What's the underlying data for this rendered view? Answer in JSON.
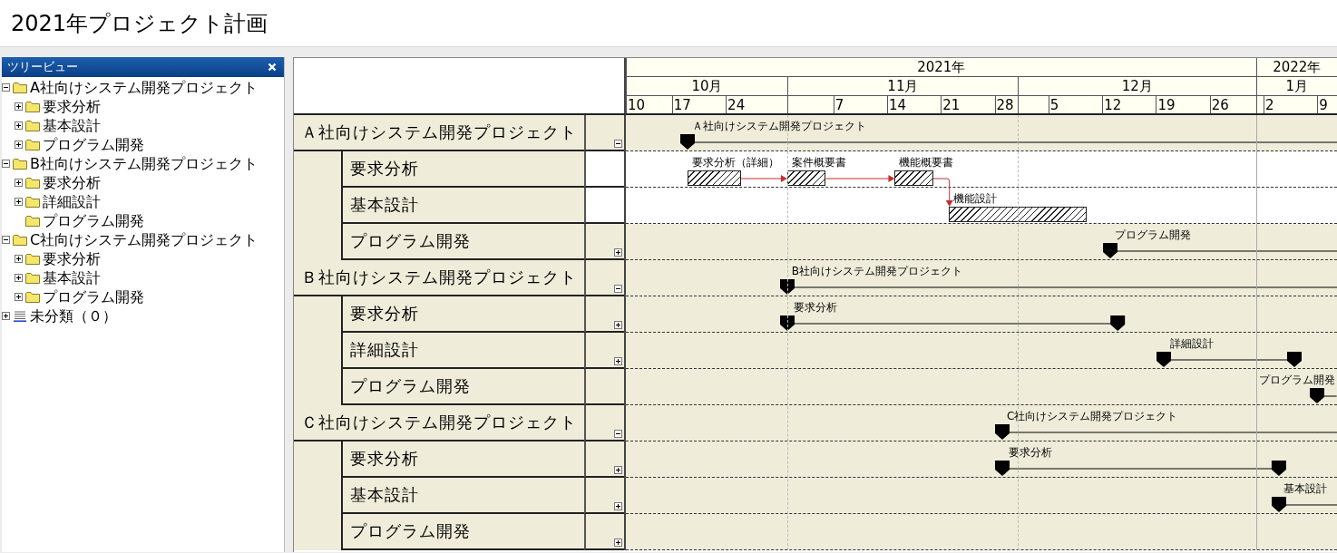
{
  "title": "2021年プロジェクト計画",
  "tree": {
    "header": "ツリービュー",
    "nodes": [
      {
        "label": "A社向けシステム開発プロジェクト",
        "kind": "folder",
        "expanded": true,
        "children": [
          {
            "label": "要求分析",
            "kind": "folder",
            "expanded": false
          },
          {
            "label": "基本設計",
            "kind": "folder",
            "expanded": false
          },
          {
            "label": "プログラム開発",
            "kind": "folder",
            "expanded": false
          }
        ]
      },
      {
        "label": "B社向けシステム開発プロジェクト",
        "kind": "folder",
        "expanded": true,
        "children": [
          {
            "label": "要求分析",
            "kind": "folder",
            "expanded": false
          },
          {
            "label": "詳細設計",
            "kind": "folder",
            "expanded": false
          },
          {
            "label": "プログラム開発",
            "kind": "leaf"
          }
        ]
      },
      {
        "label": "C社向けシステム開発プロジェクト",
        "kind": "folder",
        "expanded": true,
        "children": [
          {
            "label": "要求分析",
            "kind": "folder",
            "expanded": false
          },
          {
            "label": "基本設計",
            "kind": "folder",
            "expanded": false
          },
          {
            "label": "プログラム開発",
            "kind": "folder",
            "expanded": false
          }
        ]
      },
      {
        "label": "未分類（０）",
        "kind": "list",
        "expanded": false
      }
    ]
  },
  "timeline": {
    "years": [
      {
        "label": "2021年"
      },
      {
        "label": "2022年"
      }
    ],
    "months": [
      {
        "label": "10月"
      },
      {
        "label": "11月"
      },
      {
        "label": "12月"
      },
      {
        "label": "1月"
      }
    ],
    "weeks": [
      {
        "label": "10"
      },
      {
        "label": "17"
      },
      {
        "label": "24"
      },
      {
        "label": "7"
      },
      {
        "label": "14"
      },
      {
        "label": "21"
      },
      {
        "label": "28"
      },
      {
        "label": "5"
      },
      {
        "label": "12"
      },
      {
        "label": "19"
      },
      {
        "label": "26"
      },
      {
        "label": "2"
      },
      {
        "label": "9"
      }
    ]
  },
  "gantt": {
    "rows": [
      {
        "label": "Ａ社向けシステム開発プロジェクト",
        "kind": "project",
        "expanded": true,
        "items": [
          {
            "kind": "summary",
            "label": "Ａ社向けシステム開発プロジェクト"
          }
        ]
      },
      {
        "label": "要求分析",
        "kind": "open_task",
        "items": [
          {
            "kind": "bar",
            "label": "要求分析（詳細）",
            "linked": true
          },
          {
            "kind": "bar",
            "label": "案件概要書",
            "linked": true
          },
          {
            "kind": "bar",
            "label": "機能概要書",
            "linked": true
          }
        ]
      },
      {
        "label": "基本設計",
        "kind": "open_task",
        "items": [
          {
            "kind": "bar",
            "label": "機能設計"
          }
        ]
      },
      {
        "label": "プログラム開発",
        "kind": "task",
        "expanded": false,
        "items": [
          {
            "kind": "summary",
            "label": "プログラム開発"
          }
        ]
      },
      {
        "label": "Ｂ社向けシステム開発プロジェクト",
        "kind": "project",
        "expanded": true,
        "items": [
          {
            "kind": "summary",
            "label": "B社向けシステム開発プロジェクト"
          }
        ]
      },
      {
        "label": "要求分析",
        "kind": "task",
        "expanded": false,
        "items": [
          {
            "kind": "span",
            "label": "要求分析"
          }
        ]
      },
      {
        "label": "詳細設計",
        "kind": "task",
        "expanded": false,
        "items": [
          {
            "kind": "span",
            "label": "詳細設計"
          }
        ]
      },
      {
        "label": "プログラム開発",
        "kind": "leaf_task",
        "items": [
          {
            "kind": "summary",
            "label": "プログラム開発"
          }
        ]
      },
      {
        "label": "Ｃ社向けシステム開発プロジェクト",
        "kind": "project",
        "expanded": true,
        "items": [
          {
            "kind": "summary",
            "label": "C社向けシステム開発プロジェクト"
          }
        ]
      },
      {
        "label": "要求分析",
        "kind": "task",
        "expanded": false,
        "items": [
          {
            "kind": "span",
            "label": "要求分析"
          }
        ]
      },
      {
        "label": "基本設計",
        "kind": "task",
        "expanded": false,
        "items": [
          {
            "kind": "summary",
            "label": "基本設計"
          }
        ]
      },
      {
        "label": "プログラム開発",
        "kind": "task",
        "expanded": false,
        "items": []
      }
    ]
  }
}
